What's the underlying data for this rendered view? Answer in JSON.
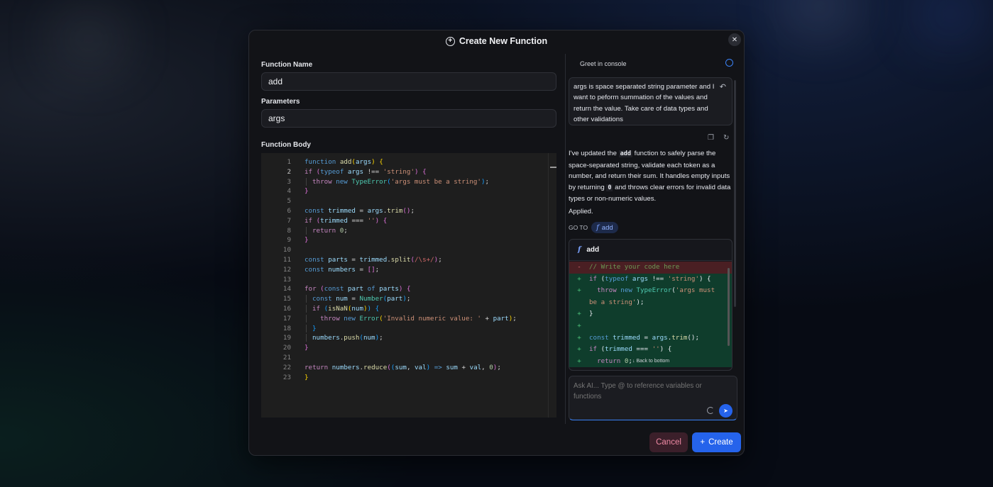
{
  "modal": {
    "title": "Create New Function",
    "close_icon": "close-icon"
  },
  "form": {
    "function_name_label": "Function Name",
    "function_name_value": "add",
    "parameters_label": "Parameters",
    "parameters_value": "args",
    "function_body_label": "Function Body"
  },
  "editor": {
    "active_line": 2,
    "line_numbers": [
      "1",
      "2",
      "3",
      "4",
      "5",
      "6",
      "7",
      "8",
      "9",
      "10",
      "11",
      "12",
      "13",
      "14",
      "15",
      "16",
      "17",
      "18",
      "19",
      "20",
      "21",
      "22",
      "23"
    ]
  },
  "chat": {
    "header_title": "Greet in console",
    "user_message": "args is space separated string parameter and I want to peform summation of the values and return the value. Take care of data types and other validations",
    "ai_message_pre": "I've updated the ",
    "ai_message_code": "add",
    "ai_message_mid": " function to safely parse the space-separated string, validate each token as a number, and return their sum. It handles empty inputs by returning ",
    "ai_message_zero": "0",
    "ai_message_post": " and throws clear errors for invalid data types or non-numeric values.",
    "applied": "Applied.",
    "goto_label": "GO TO",
    "goto_chip": "add",
    "diff_title": "add",
    "back_to_bottom": "↓ Back to bottom",
    "ask_placeholder": "Ask AI... Type @ to reference variables or functions"
  },
  "footer": {
    "cancel": "Cancel",
    "create": "Create"
  },
  "colors": {
    "accent": "#2563eb",
    "cancel_bg": "#3b1f2a",
    "diff_add": "#0f3d2c",
    "diff_del": "#4a1f23"
  }
}
